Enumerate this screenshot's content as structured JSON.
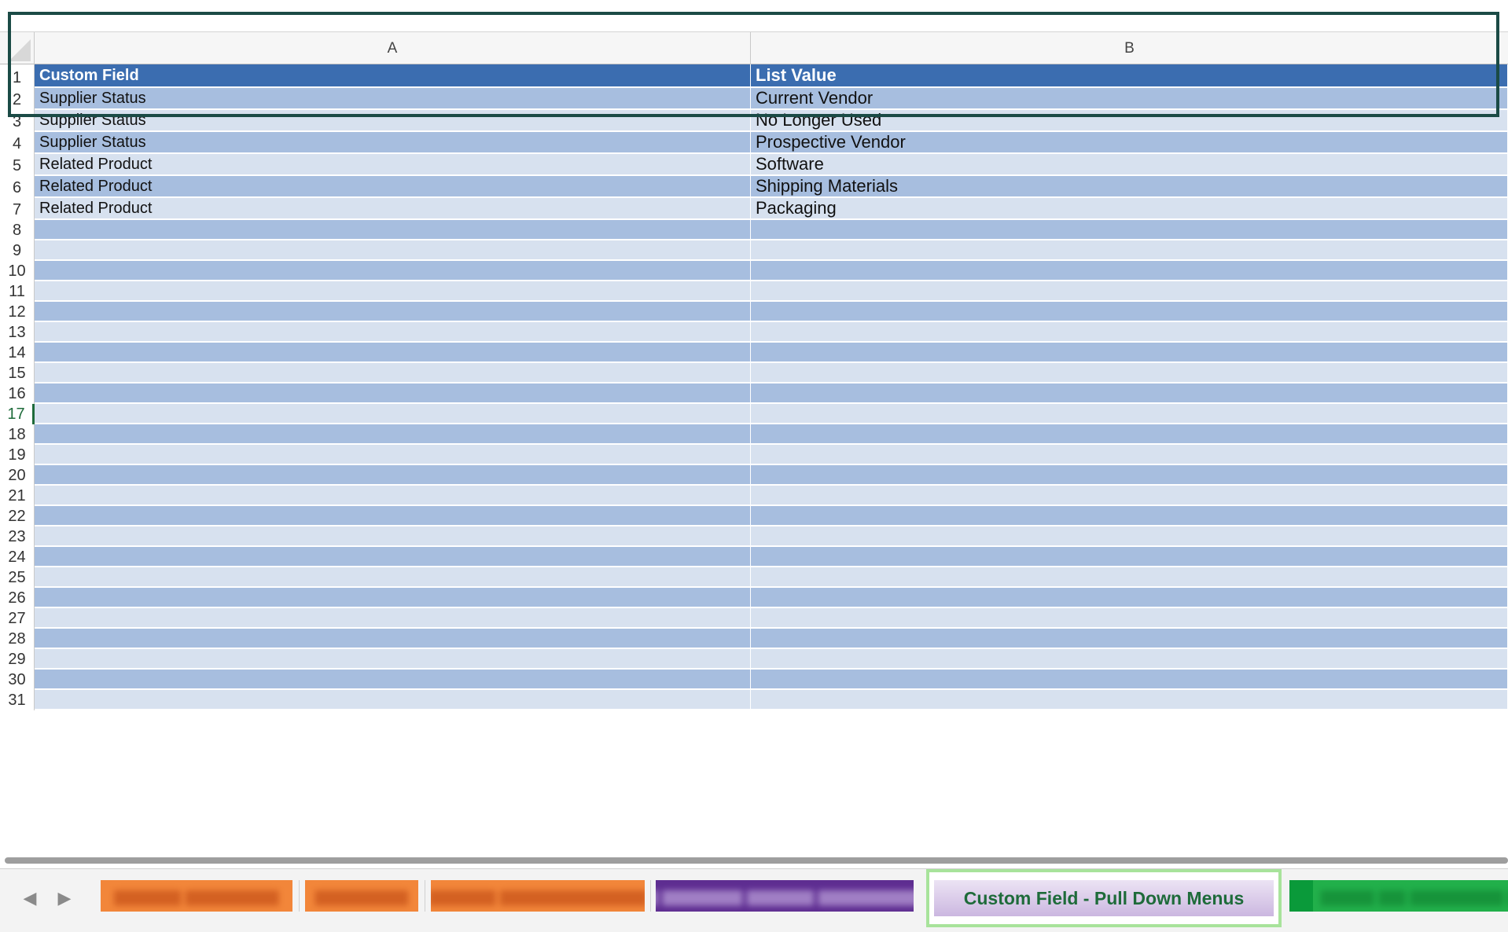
{
  "columns": [
    "A",
    "B"
  ],
  "rows": [
    {
      "num": "1",
      "a": "Custom Field",
      "b": "List Value"
    },
    {
      "num": "2",
      "a": "Supplier Status",
      "b": "Current Vendor"
    },
    {
      "num": "3",
      "a": "Supplier Status",
      "b": "No Longer Used"
    },
    {
      "num": "4",
      "a": "Supplier Status",
      "b": "Prospective Vendor"
    },
    {
      "num": "5",
      "a": "Related Product",
      "b": "Software"
    },
    {
      "num": "6",
      "a": "Related Product",
      "b": "Shipping Materials"
    },
    {
      "num": "7",
      "a": "Related Product",
      "b": "Packaging"
    },
    {
      "num": "8",
      "a": "",
      "b": ""
    },
    {
      "num": "9",
      "a": "",
      "b": ""
    },
    {
      "num": "10",
      "a": "",
      "b": ""
    },
    {
      "num": "11",
      "a": "",
      "b": ""
    },
    {
      "num": "12",
      "a": "",
      "b": ""
    },
    {
      "num": "13",
      "a": "",
      "b": ""
    },
    {
      "num": "14",
      "a": "",
      "b": ""
    },
    {
      "num": "15",
      "a": "",
      "b": ""
    },
    {
      "num": "16",
      "a": "",
      "b": ""
    },
    {
      "num": "17",
      "a": "",
      "b": ""
    },
    {
      "num": "18",
      "a": "",
      "b": ""
    },
    {
      "num": "19",
      "a": "",
      "b": ""
    },
    {
      "num": "20",
      "a": "",
      "b": ""
    },
    {
      "num": "21",
      "a": "",
      "b": ""
    },
    {
      "num": "22",
      "a": "",
      "b": ""
    },
    {
      "num": "23",
      "a": "",
      "b": ""
    },
    {
      "num": "24",
      "a": "",
      "b": ""
    },
    {
      "num": "25",
      "a": "",
      "b": ""
    },
    {
      "num": "26",
      "a": "",
      "b": ""
    },
    {
      "num": "27",
      "a": "",
      "b": ""
    },
    {
      "num": "28",
      "a": "",
      "b": ""
    },
    {
      "num": "29",
      "a": "",
      "b": ""
    },
    {
      "num": "30",
      "a": "",
      "b": ""
    },
    {
      "num": "31",
      "a": "",
      "b": ""
    }
  ],
  "active_row": "17",
  "tabs": {
    "prev_icon": "chevron-left-icon",
    "next_icon": "chevron-right-icon",
    "prev_glyph": "◀",
    "next_glyph": "▶",
    "active_label": "Custom Field - Pull Down Menus"
  },
  "colors": {
    "header_fill": "#3b6db0",
    "band_dark": "#a7bedf",
    "band_light": "#d7e1ef",
    "selection_border": "#1b4b46",
    "active_tab_outline": "#a8e39b",
    "active_tab_text": "#1e6b3a"
  }
}
